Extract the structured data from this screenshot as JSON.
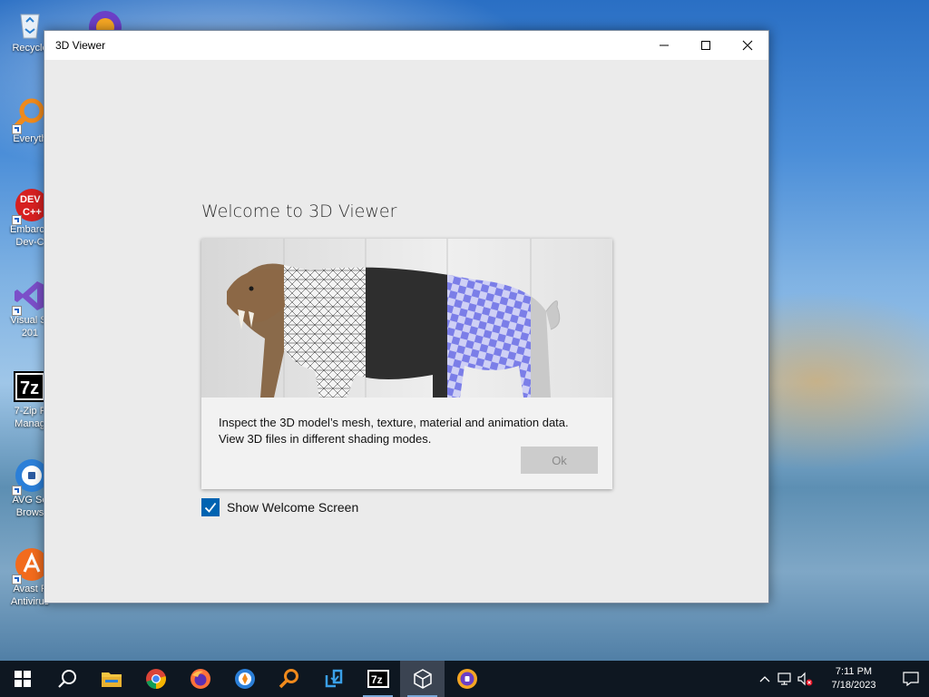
{
  "desktop": {
    "icons": [
      {
        "label": "Recycle",
        "name": "recycle-bin-icon"
      },
      {
        "label": "Everyth",
        "name": "everything-search-icon"
      },
      {
        "label": "Embarca\nDev-C",
        "name": "embarcadero-dev-cpp-icon"
      },
      {
        "label": "Visual St\n201",
        "name": "visual-studio-icon"
      },
      {
        "label": "7-Zip F\nManag",
        "name": "7zip-file-manager-icon"
      },
      {
        "label": "AVG Se\nBrows",
        "name": "avg-secure-browser-icon"
      },
      {
        "label": "Avast F\nAntivirus",
        "name": "avast-antivirus-icon"
      }
    ]
  },
  "window": {
    "title": "3D Viewer",
    "controls": {
      "minimize": "minimize",
      "maximize": "maximize",
      "close": "close"
    }
  },
  "welcome": {
    "heading": "Welcome to 3D Viewer",
    "description_line1": "Inspect the 3D model’s mesh, texture, material and animation data.",
    "description_line2": "View 3D files in different shading modes.",
    "ok_label": "Ok",
    "show_welcome_label": "Show Welcome Screen",
    "show_welcome_checked": true
  },
  "taskbar": {
    "items": [
      {
        "name": "start-icon",
        "interactable": true
      },
      {
        "name": "search-icon",
        "interactable": true
      },
      {
        "name": "file-explorer-icon",
        "interactable": true
      },
      {
        "name": "chrome-icon",
        "interactable": true
      },
      {
        "name": "firefox-icon",
        "interactable": true
      },
      {
        "name": "avg-browser-taskbar-icon",
        "interactable": true
      },
      {
        "name": "everything-taskbar-icon",
        "interactable": true
      },
      {
        "name": "visual-studio-installer-icon",
        "interactable": true
      },
      {
        "name": "7zip-taskbar-icon",
        "interactable": true
      },
      {
        "name": "3d-viewer-taskbar-icon",
        "interactable": true
      },
      {
        "name": "avg-secure-browser-taskbar-icon",
        "interactable": true
      }
    ],
    "clock": {
      "time": "7:11 PM",
      "date": "7/18/2023"
    }
  },
  "colors": {
    "accent": "#0063b1",
    "taskbar": "#0e1721",
    "window_bg": "#ebebeb"
  }
}
